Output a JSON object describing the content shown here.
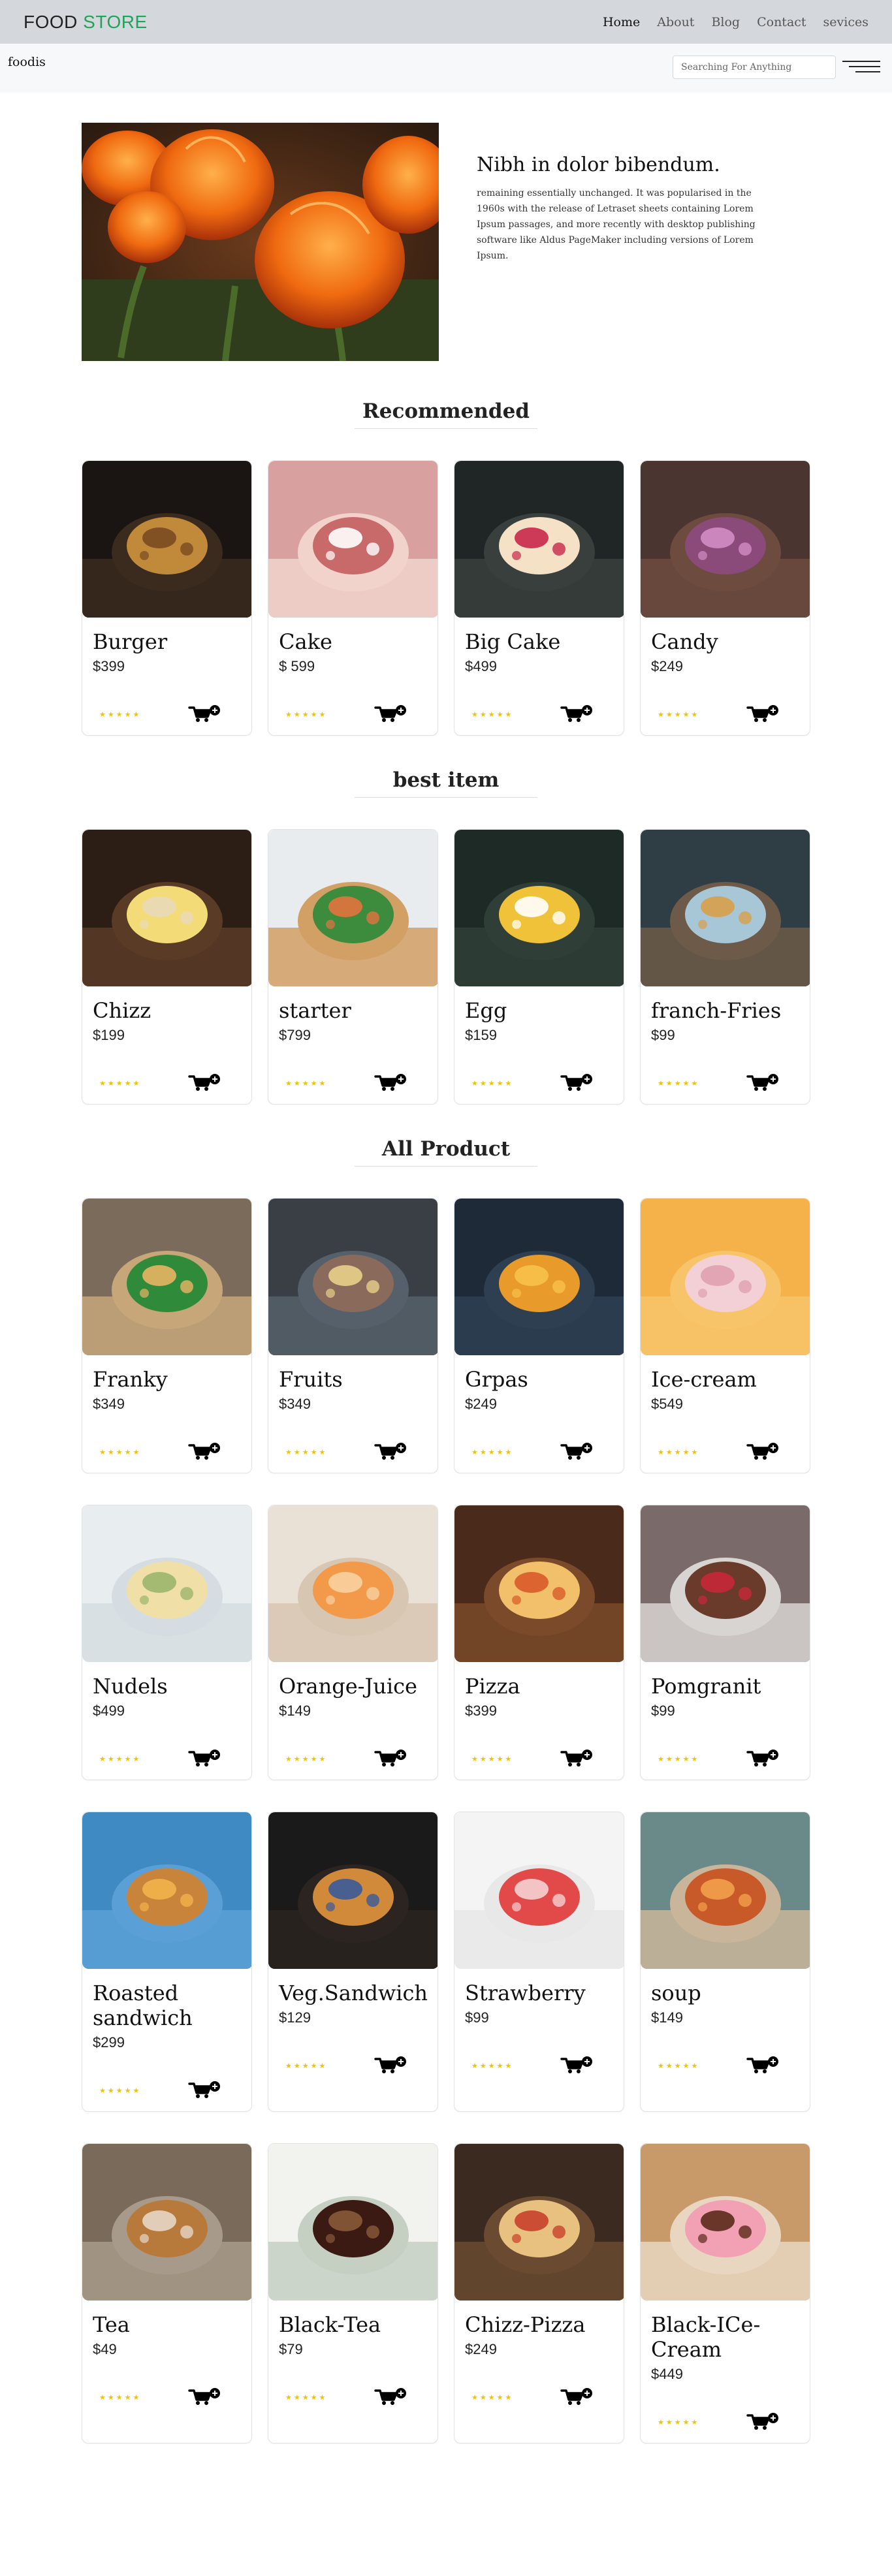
{
  "nav": {
    "brand_part1": "FOOD",
    "brand_part2": "STORE",
    "links": [
      "Home",
      "About",
      "Blog",
      "Contact",
      "sevices"
    ]
  },
  "subbar": {
    "logo_text": "foodis",
    "search_placeholder": "Searching For Anything"
  },
  "hero": {
    "title": "Nibh in dolor bibendum.",
    "description": "remaining essentially unchanged. It was popularised in the 1960s with the release of Letraset sheets containing Lorem Ipsum passages, and more recently with desktop publishing software like Aldus PageMaker including versions of Lorem Ipsum."
  },
  "sections": {
    "recommended": {
      "title": "Recommended",
      "items": [
        {
          "name": "Burger",
          "price": "$399"
        },
        {
          "name": "Cake",
          "price": "$ 599"
        },
        {
          "name": "Big Cake",
          "price": "$499"
        },
        {
          "name": "Candy",
          "price": "$249"
        }
      ]
    },
    "best": {
      "title": "best item",
      "items": [
        {
          "name": "Chizz",
          "price": "$199"
        },
        {
          "name": "starter",
          "price": "$799"
        },
        {
          "name": "Egg",
          "price": "$159"
        },
        {
          "name": "franch-Fries",
          "price": "$99"
        }
      ]
    },
    "all": {
      "title": "All Product",
      "items": [
        {
          "name": "Franky",
          "price": "$349"
        },
        {
          "name": "Fruits",
          "price": "$349"
        },
        {
          "name": "Grpas",
          "price": "$249"
        },
        {
          "name": "Ice-cream",
          "price": "$549"
        },
        {
          "name": "Nudels",
          "price": "$499"
        },
        {
          "name": "Orange-Juice",
          "price": "$149"
        },
        {
          "name": "Pizza",
          "price": "$399"
        },
        {
          "name": "Pomgranit",
          "price": "$99"
        },
        {
          "name": "Roasted sandwich",
          "price": "$299"
        },
        {
          "name": "Veg.Sandwich",
          "price": "$129"
        },
        {
          "name": "Strawberry",
          "price": "$99"
        },
        {
          "name": "soup",
          "price": "$149"
        },
        {
          "name": "Tea",
          "price": "$49"
        },
        {
          "name": "Black-Tea",
          "price": "$79"
        },
        {
          "name": "Chizz-Pizza",
          "price": "$249"
        },
        {
          "name": "Black-ICe-Cream",
          "price": "$449"
        }
      ]
    }
  },
  "rating_stars": 5,
  "colors": {
    "accent": "#21a35a",
    "star": "#f2c200",
    "navbar_bg": "#d4d8dd"
  },
  "icons": {
    "cart": "cart-plus-icon",
    "menu": "hamburger-menu-icon",
    "star": "star-icon"
  }
}
